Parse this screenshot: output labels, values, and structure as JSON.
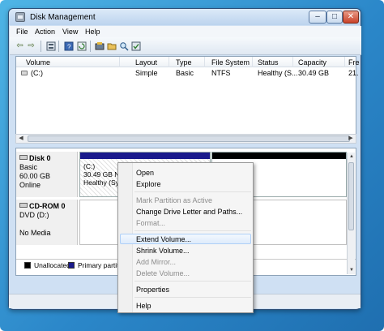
{
  "window": {
    "title": "Disk Management",
    "min": "–",
    "max": "□",
    "close": "✕"
  },
  "menu": [
    "File",
    "Action",
    "View",
    "Help"
  ],
  "toolbar": {
    "back": "⇦",
    "forward": "⇨",
    "icons": [
      "properties-icon",
      "help-icon",
      "refresh-icon",
      "connect-icon",
      "open-icon",
      "search-icon",
      "check-icon"
    ]
  },
  "volumes": {
    "columns": [
      "Volume",
      "Layout",
      "Type",
      "File System",
      "Status",
      "Capacity",
      "Fre"
    ],
    "rows": [
      [
        "(C:)",
        "Simple",
        "Basic",
        "NTFS",
        "Healthy (S...",
        "30.49 GB",
        "21."
      ]
    ]
  },
  "disks": {
    "disk0": {
      "name": "Disk 0",
      "type": "Basic",
      "size": "60.00 GB",
      "state": "Online",
      "partition": {
        "label": "(C:)",
        "detail": "30.49 GB NTF",
        "status": "Healthy (Syst"
      }
    },
    "cdrom": {
      "name": "CD-ROM 0",
      "drive": "DVD (D:)",
      "media": "No Media"
    }
  },
  "legend": {
    "unallocated": "Unallocated",
    "primary": "Primary partiti"
  },
  "colors": {
    "unallocated": "#000000",
    "primary": "#1a1a8c",
    "highlight": "#deebfb"
  },
  "context_menu": {
    "open": "Open",
    "explore": "Explore",
    "mark_active": "Mark Partition as Active",
    "change_letter": "Change Drive Letter and Paths...",
    "format": "Format...",
    "extend": "Extend Volume...",
    "shrink": "Shrink Volume...",
    "add_mirror": "Add Mirror...",
    "delete": "Delete Volume...",
    "properties": "Properties",
    "help": "Help"
  }
}
